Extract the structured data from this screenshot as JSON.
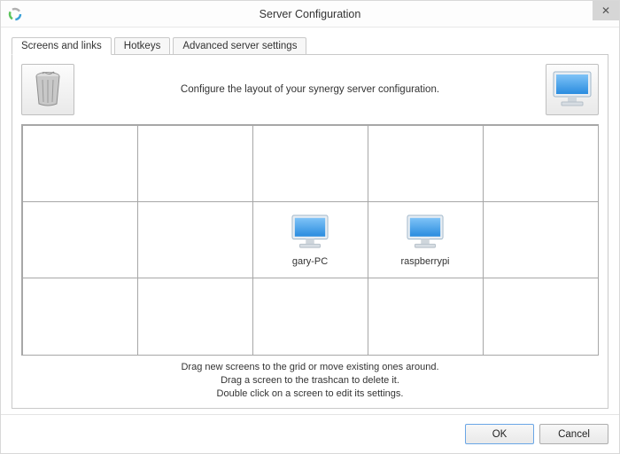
{
  "window": {
    "title": "Server Configuration",
    "close_glyph": "✕"
  },
  "tabs": {
    "screens": "Screens and links",
    "hotkeys": "Hotkeys",
    "advanced": "Advanced server settings"
  },
  "instruct": "Configure the layout of your synergy server configuration.",
  "grid": {
    "cols": 5,
    "rows": 3,
    "screens": [
      {
        "row": 1,
        "col": 2,
        "name": "gary-PC"
      },
      {
        "row": 1,
        "col": 3,
        "name": "raspberrypi"
      }
    ]
  },
  "hints": {
    "line1": "Drag new screens to the grid or move existing ones around.",
    "line2": "Drag a screen to the trashcan to delete it.",
    "line3": "Double click on a screen to edit its settings."
  },
  "buttons": {
    "ok": "OK",
    "cancel": "Cancel"
  }
}
